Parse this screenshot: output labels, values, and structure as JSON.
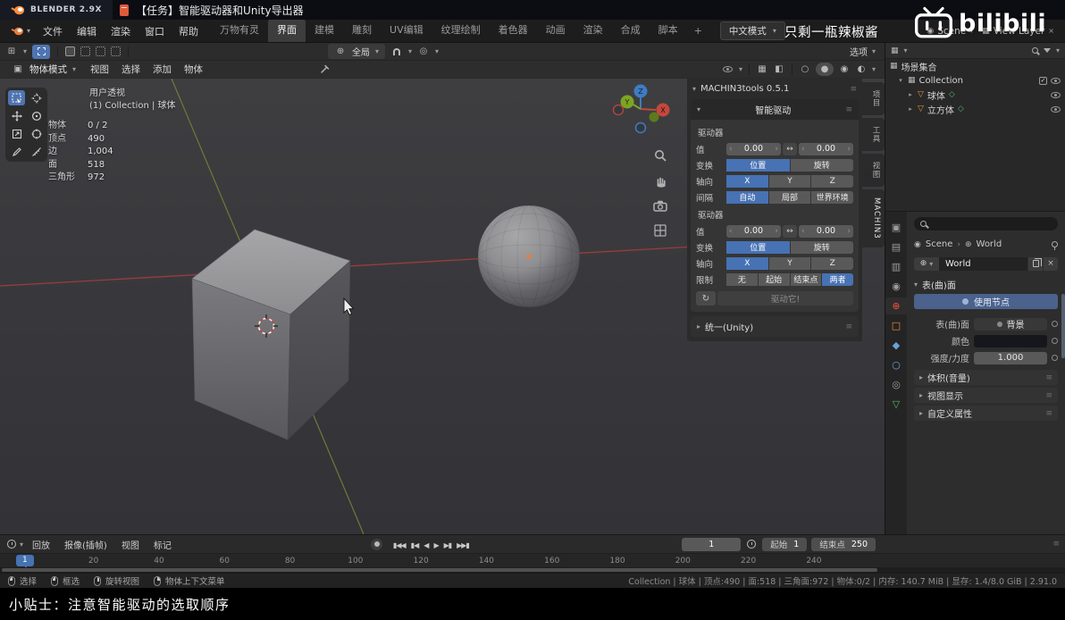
{
  "icons": {
    "caret_down": "▾",
    "caret_right": "▸",
    "grip": "≡",
    "close": "×",
    "swap": "↔",
    "loop": "↻",
    "check": "✓",
    "plus": "+",
    "breadcrumb_sep": "›",
    "globe": "⊕",
    "scene_glyph": "◉",
    "collection": "▦",
    "mesh_tri": "▽",
    "data_diamond": "◇",
    "editor_grid": "⊞",
    "proportional": "◎",
    "overlays": "▦",
    "xray": "◧",
    "shade_wire": "○",
    "shade_solid": "●",
    "shade_material": "◉",
    "shade_rendered": "◐",
    "mode_glyph": "▣"
  },
  "colors": {
    "accent": "#4772b3",
    "world_red": "#d0473d",
    "object_orange": "#e8913c",
    "mesh_green": "#4fba6f"
  },
  "video_bar": {
    "brand": "BLENDER 2.9X",
    "title": "【任务】智能驱动器和Unity导出器"
  },
  "watermark": {
    "text": "只剩一瓶辣椒酱",
    "logo": "bilibili"
  },
  "tip_bar": {
    "text": "小贴士：注意智能驱动的选取顺序"
  },
  "topbar": {
    "menus": [
      "文件",
      "编辑",
      "渲染",
      "窗口",
      "帮助"
    ],
    "workspaces": [
      {
        "label": "万物有灵",
        "cls": ""
      },
      {
        "label": "界面",
        "cls": "active"
      },
      {
        "label": "建模",
        "cls": ""
      },
      {
        "label": "雕刻",
        "cls": ""
      },
      {
        "label": "UV编辑",
        "cls": ""
      },
      {
        "label": "纹理绘制",
        "cls": ""
      },
      {
        "label": "着色器",
        "cls": ""
      },
      {
        "label": "动画",
        "cls": ""
      },
      {
        "label": "渲染",
        "cls": ""
      },
      {
        "label": "合成",
        "cls": ""
      },
      {
        "label": "脚本",
        "cls": ""
      }
    ],
    "add_tab": "+",
    "language_button": "中文模式",
    "scene_name": "Scene",
    "view_layer_name": "View Layer"
  },
  "tool_header": {
    "orientation": "全局",
    "options_label": "选项"
  },
  "viewport_header": {
    "mode": "物体模式",
    "menus": [
      "视图",
      "选择",
      "添加",
      "物体"
    ]
  },
  "viewport": {
    "view_name": "用户透视",
    "context": "(1) Collection | 球体",
    "stats": [
      {
        "label": "物体",
        "value": "0 / 2"
      },
      {
        "label": "顶点",
        "value": "490"
      },
      {
        "label": "边",
        "value": "1,004"
      },
      {
        "label": "面",
        "value": "518"
      },
      {
        "label": "三角形",
        "value": "972"
      }
    ],
    "axis_x": "X",
    "axis_y": "Y",
    "axis_z": "Z"
  },
  "npanel": {
    "tabs": [
      {
        "label": "项目",
        "cls": ""
      },
      {
        "label": "工具",
        "cls": ""
      },
      {
        "label": "视图",
        "cls": ""
      },
      {
        "label": "MACHIN3",
        "cls": "active"
      }
    ],
    "addon_title": "MACHIN3tools 0.5.1",
    "panel_title": "智能驱动",
    "group1": {
      "title": "驱动器",
      "value_label": "值",
      "value1": "0.00",
      "value2": "0.00",
      "transform_label": "变换",
      "transform": [
        {
          "label": "位置",
          "cls": "on"
        },
        {
          "label": "旋转",
          "cls": ""
        }
      ],
      "axis_label": "轴向",
      "axis": [
        {
          "label": "X",
          "cls": "on"
        },
        {
          "label": "Y",
          "cls": ""
        },
        {
          "label": "Z",
          "cls": ""
        }
      ],
      "mode_label": "间隔",
      "mode": [
        {
          "label": "自动",
          "cls": "on"
        },
        {
          "label": "局部",
          "cls": ""
        },
        {
          "label": "世界环境",
          "cls": ""
        }
      ]
    },
    "group2": {
      "title": "驱动器",
      "value_label": "值",
      "value1": "0.00",
      "value2": "0.00",
      "transform_label": "变换",
      "transform": [
        {
          "label": "位置",
          "cls": "on"
        },
        {
          "label": "旋转",
          "cls": ""
        }
      ],
      "axis_label": "轴向",
      "axis": [
        {
          "label": "X",
          "cls": "on"
        },
        {
          "label": "Y",
          "cls": ""
        },
        {
          "label": "Z",
          "cls": ""
        }
      ],
      "mode_label": "限制",
      "mode": [
        {
          "label": "无",
          "cls": ""
        },
        {
          "label": "起始",
          "cls": ""
        },
        {
          "label": "结束点",
          "cls": ""
        },
        {
          "label": "两者",
          "cls": "on"
        }
      ]
    },
    "drive_button": "驱动它!",
    "unity_panel": "统一(Unity)"
  },
  "outliner": {
    "root": "场景集合",
    "collection": "Collection",
    "sphere": "球体",
    "cube": "立方体"
  },
  "properties": {
    "tabs": [
      {
        "name": "render",
        "glyph": "▣",
        "cls": ""
      },
      {
        "name": "output",
        "glyph": "▤",
        "cls": ""
      },
      {
        "name": "view-layer",
        "glyph": "▥",
        "cls": ""
      },
      {
        "name": "scene",
        "glyph": "◉",
        "cls": ""
      },
      {
        "name": "world",
        "glyph": "⊕",
        "cls": "active red"
      },
      {
        "name": "object",
        "glyph": "□",
        "cls": "orange"
      },
      {
        "name": "modifiers",
        "glyph": "◆",
        "cls": "blue"
      },
      {
        "name": "physics",
        "glyph": "○",
        "cls": "blue"
      },
      {
        "name": "constraints",
        "glyph": "◎",
        "cls": ""
      },
      {
        "name": "object-data",
        "glyph": "▽",
        "cls": "green"
      }
    ],
    "breadcrumb_scene": "Scene",
    "breadcrumb_world": "World",
    "world_name": "World",
    "surface_panel": "表(曲)面",
    "use_nodes": "使用节点",
    "surface_label": "表(曲)面",
    "surface_value": "背景",
    "color_label": "颜色",
    "strength_label": "强度/力度",
    "strength_value": "1.000",
    "collapsed_panels": [
      "体积(音量)",
      "视图显示",
      "自定义属性"
    ]
  },
  "timeline": {
    "menus": [
      "回放",
      "报像(插帧)",
      "视图",
      "标记"
    ],
    "transport": [
      "▮◀◀",
      "▮◀",
      "◀",
      "▶",
      "▶▮",
      "▶▶▮"
    ],
    "current_frame": "1",
    "start_label": "起始",
    "start_value": "1",
    "end_label": "结束点",
    "end_value": "250",
    "marker": "1",
    "ticks": [
      "20",
      "40",
      "60",
      "80",
      "100",
      "120",
      "140",
      "160",
      "180",
      "200",
      "220",
      "240"
    ]
  },
  "statusbar": {
    "hints": [
      {
        "label": "选择",
        "icon": "m-left"
      },
      {
        "label": "框选",
        "icon": "m-left"
      },
      {
        "label": "旋转视图",
        "icon": "m-mid"
      },
      {
        "label": "物体上下文菜单",
        "icon": "m-right"
      }
    ],
    "info": "Collection | 球体 | 顶点:490 | 面:518 | 三角面:972 | 物体:0/2 | 内存: 140.7 MiB | 显存: 1.4/8.0 GiB | 2.91.0"
  }
}
